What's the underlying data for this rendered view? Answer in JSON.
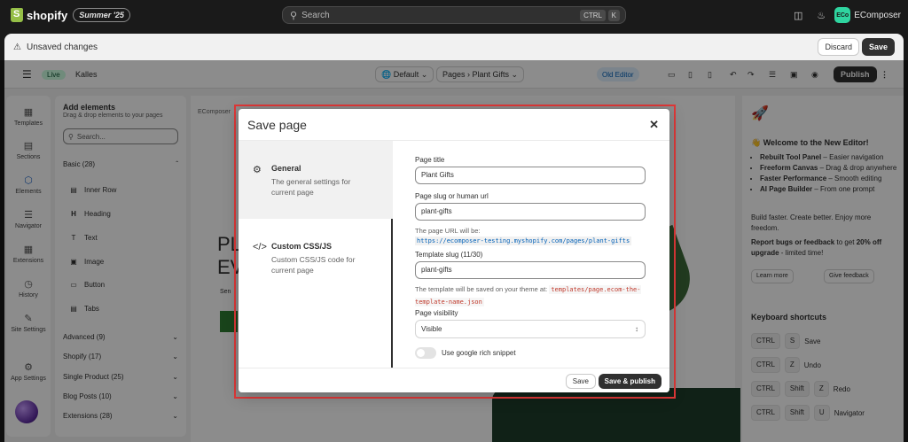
{
  "shopify": {
    "logo_text": "shopify",
    "edition_badge": "Summer '25",
    "search_placeholder": "Search",
    "search_kbd_1": "CTRL",
    "search_kbd_2": "K",
    "store_initials": "ECo",
    "store_name": "EComposer"
  },
  "unsaved_bar": {
    "message": "Unsaved changes",
    "discard_label": "Discard",
    "save_label": "Save"
  },
  "editor_toolbar": {
    "status": "Live",
    "theme_name": "Kalles",
    "device_select": "Default",
    "page_type": "Pages",
    "page_name": "Plant Gifts",
    "old_editor_label": "Old Editor",
    "publish_label": "Publish"
  },
  "rail": [
    {
      "label": "Templates",
      "icon": "templates-icon"
    },
    {
      "label": "Sections",
      "icon": "sections-icon"
    },
    {
      "label": "Elements",
      "icon": "elements-icon"
    },
    {
      "label": "Navigator",
      "icon": "navigator-icon"
    },
    {
      "label": "Extensions",
      "icon": "extensions-icon"
    },
    {
      "label": "History",
      "icon": "history-icon"
    },
    {
      "label": "Site Settings",
      "icon": "site-settings-icon"
    },
    {
      "label": "App Settings",
      "icon": "app-settings-icon"
    }
  ],
  "add_elements": {
    "title": "Add elements",
    "subtitle": "Drag & drop elements to your pages",
    "search_placeholder": "Search...",
    "basic_category": "Basic (28)",
    "items": [
      "Inner Row",
      "Heading",
      "Text",
      "Image",
      "Button",
      "Tabs"
    ],
    "categories": [
      "Advanced (9)",
      "Shopify (17)",
      "Single Product (25)",
      "Blog Posts (10)",
      "Extensions (28)"
    ]
  },
  "canvas": {
    "brand_text": "EComposer",
    "hero_line_1": "PL",
    "hero_line_2": "EV",
    "small_text": "Sen"
  },
  "right_panel": {
    "welcome_title": "Welcome to the New Editor!",
    "features": [
      {
        "bold": "Rebuilt Tool Panel",
        "text": " – Easier navigation"
      },
      {
        "bold": "Freeform Canvas",
        "text": " – Drag & drop anywhere"
      },
      {
        "bold": "Faster Performance",
        "text": " – Smooth editing"
      },
      {
        "bold": "AI Page Builder",
        "text": " – From one prompt"
      }
    ],
    "tagline": "Build faster. Create better. Enjoy more freedom.",
    "report_bold": "Report bugs or feedback",
    "report_text": " to get ",
    "report_offer": "20% off upgrade",
    "report_tail": " - limited time!",
    "learn_more": "Learn more",
    "give_feedback": "Give feedback",
    "shortcuts_title": "Keyboard shortcuts",
    "shortcuts": [
      {
        "keys": [
          "CTRL",
          "S"
        ],
        "action": "Save"
      },
      {
        "keys": [
          "CTRL",
          "Z"
        ],
        "action": "Undo"
      },
      {
        "keys": [
          "CTRL",
          "Shift",
          "Z"
        ],
        "action": "Redo"
      },
      {
        "keys": [
          "CTRL",
          "Shift",
          "U"
        ],
        "action": "Navigator"
      }
    ]
  },
  "modal": {
    "title": "Save page",
    "nav": [
      {
        "title": "General",
        "desc": "The general settings for current page",
        "icon": "gear-icon"
      },
      {
        "title": "Custom CSS/JS",
        "desc": "Custom CSS/JS code for current page",
        "icon": "code-icon"
      }
    ],
    "page_title_label": "Page title",
    "page_title_value": "Plant Gifts",
    "slug_label": "Page slug or human url",
    "slug_value": "plant-gifts",
    "url_help": "The page URL will be:",
    "url_value": "https://ecomposer-testing.myshopify.com/pages/plant-gifts",
    "template_slug_label": "Template slug (11/30)",
    "template_slug_value": "plant-gifts",
    "template_help": "The template will be saved on your theme at:",
    "template_path": "templates/page.ecom-the-template-name.json",
    "visibility_label": "Page visibility",
    "visibility_value": "Visible",
    "rich_snippet_label": "Use google rich snippet",
    "save_label": "Save",
    "save_publish_label": "Save & publish"
  }
}
